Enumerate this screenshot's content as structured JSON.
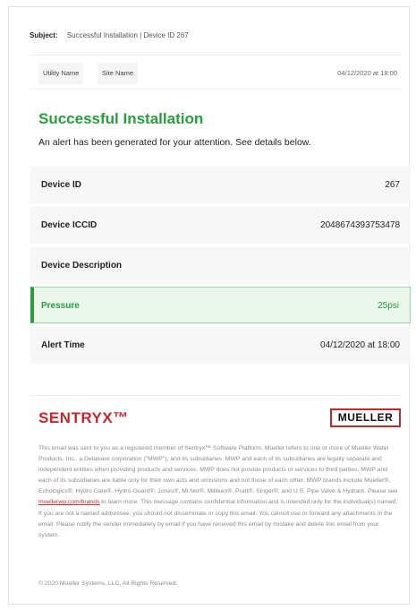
{
  "email": {
    "subject_label": "Subject:",
    "subject_text": "Successful Installation | Device ID 267"
  },
  "meta": {
    "utility_name": "Utility Name",
    "site_name": "Site Name",
    "date": "04/12/2020 at 18:00"
  },
  "alert": {
    "title": "Successful Installation",
    "intro": "An alert has been generated for your attention. See details below."
  },
  "details": [
    {
      "label": "Device ID",
      "value": "267"
    },
    {
      "label": "Device ICCID",
      "value": "2048674393753478"
    },
    {
      "label": "Device Description",
      "value": ""
    },
    {
      "label": "Pressure",
      "value": "25psi"
    },
    {
      "label": "Alert Time",
      "value": "04/12/2020 at 18:00"
    }
  ],
  "brands": {
    "left": "SENTRYX™",
    "right": "MUELLER"
  },
  "footer": {
    "legal_part1": "This email was sent to you as a registered member of Sentryx™ Software Platform. Mueller refers to one or more of Mueller Water Products, Inc., a Delaware corporation (\"MWP\"), and its subsidiaries. MWP and each of its subsidiaries are legally separate and independent entities when providing products and services. MWP does not provide products or services to third parties. MWP and each of its subsidiaries are liable only for their own acts and omissions and not those of each other. MWP brands include Mueller®, Echologics®, Hydro Gate®, Hydro-Guard®, Jones®, Mi.Net®, Milliken®, Pratt®, Singer®, and U.S. Pipe Valve & Hydrant. Please see ",
    "legal_link": "muellerwp.com/brands",
    "legal_part2": " to learn more. This message contains confidential information and is intended only for the individual(s) named. If you are not a named addressee, you should not disseminate or copy this email. You cannot use or forward any attachments in the email. Please notify the sender immediately by email if you have received this email by mistake and delete this email from your system.",
    "copyright": "© 2020 Mueller Systems, LLC. All Rights Reserved."
  },
  "colors": {
    "accent_green": "#2a9d3e",
    "brand_red": "#c0282f"
  }
}
